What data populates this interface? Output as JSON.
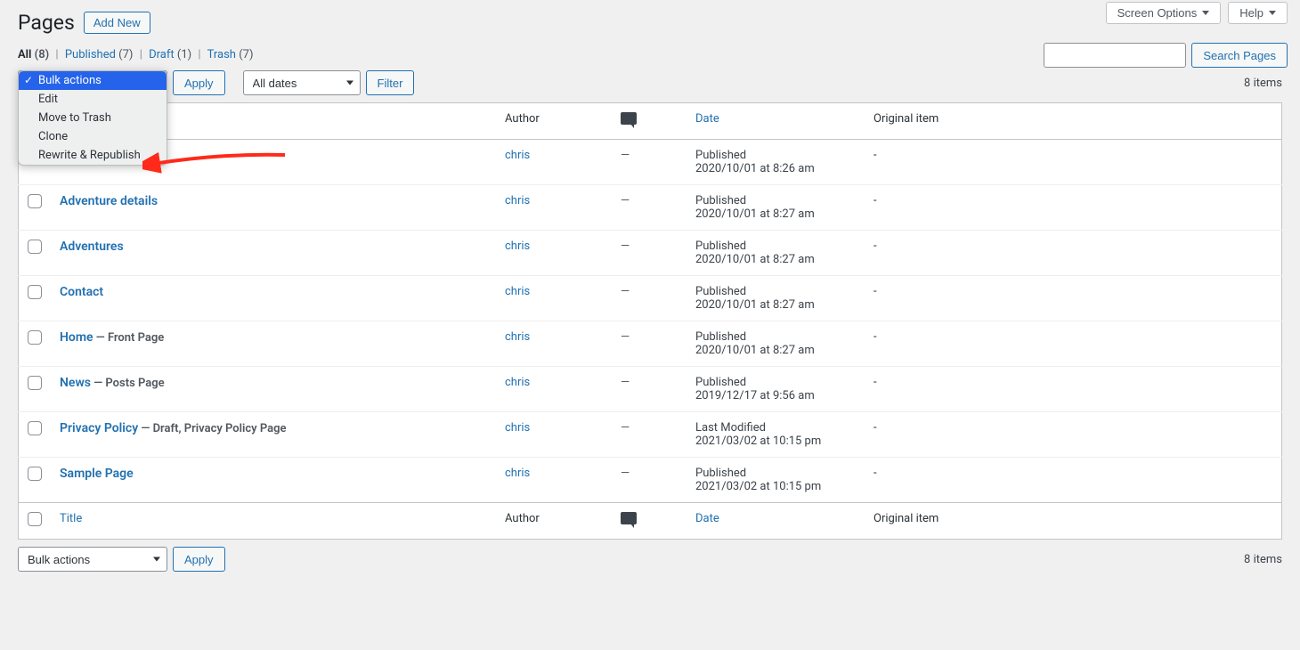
{
  "topButtons": {
    "screenOptions": "Screen Options",
    "help": "Help"
  },
  "heading": "Pages",
  "addNewLabel": "Add New",
  "filters": {
    "all": {
      "label": "All",
      "count": "(8)"
    },
    "published": {
      "label": "Published",
      "count": "(7)"
    },
    "draft": {
      "label": "Draft",
      "count": "(1)"
    },
    "trash": {
      "label": "Trash",
      "count": "(7)"
    }
  },
  "search": {
    "buttonLabel": "Search Pages",
    "value": ""
  },
  "bulk": {
    "label": "Bulk actions",
    "options": [
      "Bulk actions",
      "Edit",
      "Move to Trash",
      "Clone",
      "Rewrite & Republish"
    ],
    "applyLabel": "Apply"
  },
  "dateFilter": {
    "selected": "All dates"
  },
  "filterButton": "Filter",
  "itemCount": "8 items",
  "columns": {
    "title": "Title",
    "author": "Author",
    "comments": "comments-icon",
    "date": "Date",
    "original": "Original item"
  },
  "rows": [
    {
      "title": "",
      "state": "",
      "author": "chris",
      "comments": "—",
      "dateStatus": "Published",
      "dateValue": "2020/10/01 at 8:26 am",
      "original": "-"
    },
    {
      "title": "Adventure details",
      "state": "",
      "author": "chris",
      "comments": "—",
      "dateStatus": "Published",
      "dateValue": "2020/10/01 at 8:27 am",
      "original": "-"
    },
    {
      "title": "Adventures",
      "state": "",
      "author": "chris",
      "comments": "—",
      "dateStatus": "Published",
      "dateValue": "2020/10/01 at 8:27 am",
      "original": "-"
    },
    {
      "title": "Contact",
      "state": "",
      "author": "chris",
      "comments": "—",
      "dateStatus": "Published",
      "dateValue": "2020/10/01 at 8:27 am",
      "original": "-"
    },
    {
      "title": "Home",
      "state": " — Front Page",
      "author": "chris",
      "comments": "—",
      "dateStatus": "Published",
      "dateValue": "2020/10/01 at 8:27 am",
      "original": "-"
    },
    {
      "title": "News",
      "state": " — Posts Page",
      "author": "chris",
      "comments": "—",
      "dateStatus": "Published",
      "dateValue": "2019/12/17 at 9:56 am",
      "original": "-"
    },
    {
      "title": "Privacy Policy",
      "state": " — Draft, Privacy Policy Page",
      "author": "chris",
      "comments": "—",
      "dateStatus": "Last Modified",
      "dateValue": "2021/03/02 at 10:15 pm",
      "original": "-"
    },
    {
      "title": "Sample Page",
      "state": "",
      "author": "chris",
      "comments": "—",
      "dateStatus": "Published",
      "dateValue": "2021/03/02 at 10:15 pm",
      "original": "-"
    }
  ]
}
